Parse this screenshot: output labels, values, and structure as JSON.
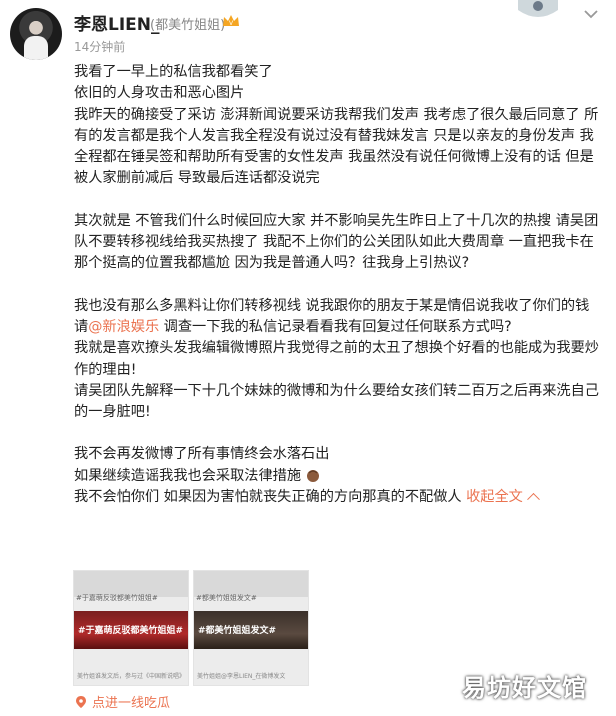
{
  "post": {
    "username": "李恩LIEN_",
    "verify_tag": "(都美竹姐姐)",
    "time": "14分钟前",
    "paragraphs": {
      "p1": "我看了一早上的私信我都看笑了",
      "p2": "依旧的人身攻击和恶心图片",
      "p3": "我昨天的确接受了采访 澎湃新闻说要采访我帮我们发声 我考虑了很久最后同意了 所有的发言都是我个人发言我全程没有说过没有替我妹发言 只是以亲友的身份发声 我全程都在锤吴签和帮助所有受害的女性发声 我虽然没有说任何微博上没有的话 但是被人家删前减后 导致最后连话都没说完",
      "p4": "其次就是 不管我们什么时候回应大家 并不影响吴先生昨日上了十几次的热搜 请吴团队不要转移视线给我买热搜了 我配不上你们的公关团队如此大费周章 一直把我卡在那个挺高的位置我都尴尬 因为我是普通人吗？往我身上引热议?",
      "p5a": "我也没有那么多黑料让你们转移视线 说我跟你的朋友于某是情侣说我收了你们的钱 请",
      "mention": "@新浪娱乐",
      "p5b": " 调查一下我的私信记录看看我有回复过任何联系方式吗?",
      "p6": "我就是喜欢撩头发我编辑微博照片我觉得之前的太丑了想换个好看的也能成为我要炒作的理由!",
      "p7": "请吴团队先解释一下十几个妹妹的微博和为什么要给女孩们转二百万之后再来洗自己的一身脏吧!",
      "p8": "我不会再发微博了所有事情终会水落石出",
      "p9": "如果继续造谣我我也会采取法律措施",
      "p10": "我不会怕你们 如果因为害怕就丧失正确的方向那真的不配做人 ",
      "collapse": "收起全文"
    },
    "images": [
      {
        "caption": "#于嘉萌反驳都美竹姐姐#",
        "banner": "#于嘉萌反驳都美竹姐姐#",
        "footer": "美竹姐谁发文后，参与过《中国新说唱》"
      },
      {
        "caption": "#都美竹姐姐发文#",
        "banner": "#都美竹姐姐发文#",
        "footer": "美竹姐姐@李恩LIEN_在微博发文"
      }
    ],
    "location": "点进一线吃瓜",
    "watermark": "易坊好文馆"
  },
  "colors": {
    "accent": "#eb7350",
    "text": "#222222",
    "muted": "#999999"
  }
}
